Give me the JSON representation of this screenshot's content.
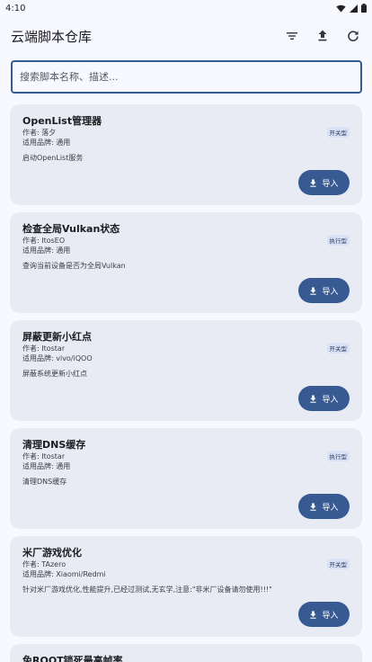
{
  "status_bar": {
    "time": "4:10"
  },
  "app_bar": {
    "title": "云端脚本仓库",
    "actions": [
      {
        "icon": "filter-icon",
        "name": "filter-button"
      },
      {
        "icon": "upload-icon",
        "name": "upload-button"
      },
      {
        "icon": "refresh-icon",
        "name": "refresh-button"
      }
    ]
  },
  "search": {
    "placeholder": "搜索脚本名称、描述...",
    "value": ""
  },
  "scripts": [
    {
      "title": "OpenList管理器",
      "author": "作者: 落夕",
      "brand": "适用品牌: 通用",
      "description": "启动OpenList服务",
      "type": "开关型",
      "button": "导入"
    },
    {
      "title": "检查全局Vulkan状态",
      "author": "作者: ItosEO",
      "brand": "适用品牌: 通用",
      "description": "查询当前设备是否为全局Vulkan",
      "type": "执行型",
      "button": "导入"
    },
    {
      "title": "屏蔽更新小红点",
      "author": "作者: Itostar",
      "brand": "适用品牌: vivo/iQOO",
      "description": "屏蔽系统更新小红点",
      "type": "开关型",
      "button": "导入"
    },
    {
      "title": "清理DNS缓存",
      "author": "作者: Itostar",
      "brand": "适用品牌: 通用",
      "description": "清理DNS缓存",
      "type": "执行型",
      "button": "导入"
    },
    {
      "title": "米厂游戏优化",
      "author": "作者: TAzero",
      "brand": "适用品牌: Xiaomi/Redmi",
      "description": "针对米厂游戏优化,性能提升,已经过测试,无玄学,注意:\"非米厂设备请勿使用!!!\"",
      "type": "开关型",
      "button": "导入"
    }
  ],
  "partial_card": {
    "title": "免ROOT锁死最高帧率"
  },
  "colors": {
    "accent": "#385a92",
    "card_bg": "#e8ebf3",
    "page_bg": "#f8f9fe"
  }
}
